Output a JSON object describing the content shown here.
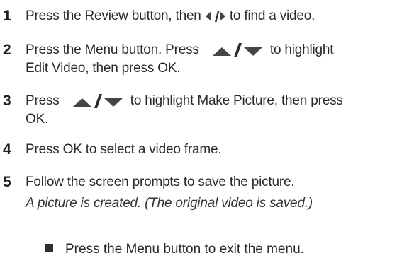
{
  "steps": [
    {
      "number": "1",
      "before_icon": "Press the Review button, then ",
      "icon": "left-right-arrows-icon",
      "after_icon": " to find a video."
    },
    {
      "number": "2",
      "before_icon": "Press the Menu button. Press ",
      "icon": "up-down-arrows-icon",
      "after_icon": " to highlight",
      "continuation": "Edit Video, then press OK."
    },
    {
      "number": "3",
      "before_icon": "Press ",
      "icon": "up-down-arrows-icon",
      "after_icon": " to highlight Make Picture, then press",
      "continuation": "OK."
    },
    {
      "number": "4",
      "text": "Press OK to select a video frame."
    },
    {
      "number": "5",
      "text": "Follow the screen prompts to save the picture.",
      "result": "A picture is created. (The original video is saved.)"
    }
  ],
  "tip": {
    "icon": "square-bullet-icon",
    "text": "Press the Menu button to exit the menu."
  },
  "colors": {
    "text": "#2a2a2a",
    "icon": "#444444"
  }
}
